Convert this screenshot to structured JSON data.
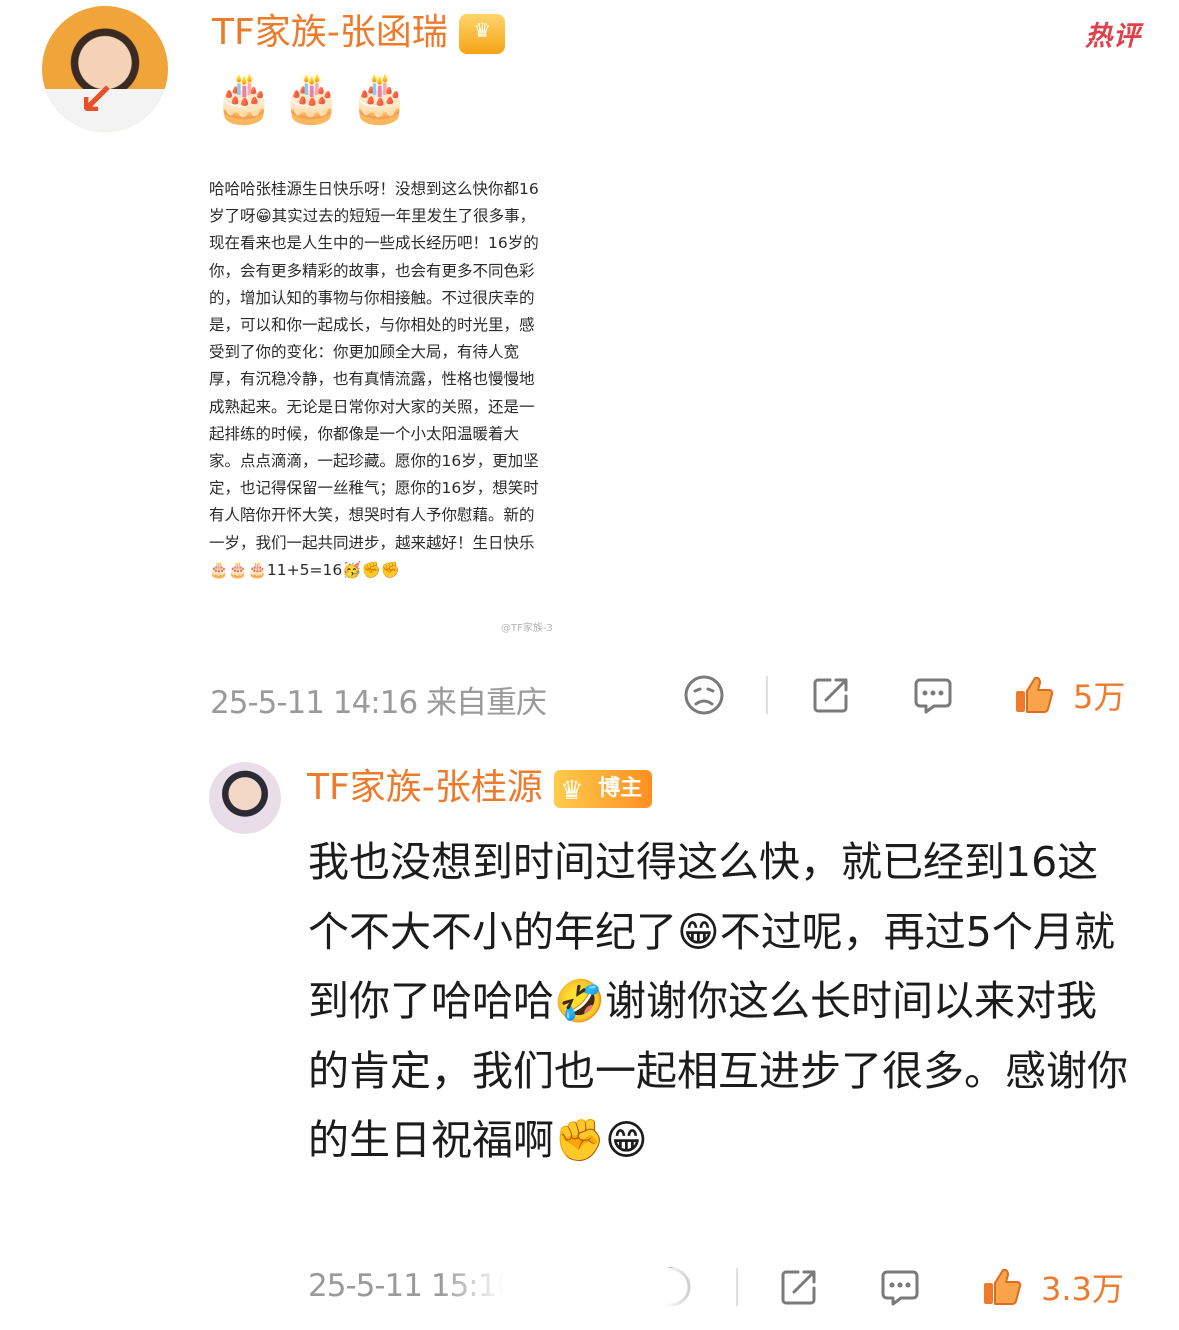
{
  "top_comment": {
    "username": "TF家族-张函瑞",
    "hot_tag": "热评",
    "emoji_line": "🎂🎂🎂",
    "image_letter": "哈哈哈张桂源生日快乐呀！没想到这么快你都16\n岁了呀😁其实过去的短短一年里发生了很多事，\n现在看来也是人生中的一些成长经历吧！16岁的\n你，会有更多精彩的故事，也会有更多不同色彩\n的，增加认知的事物与你相接触。不过很庆幸的\n是，可以和你一起成长，与你相处的时光里，感\n受到了你的变化：你更加顾全大局，有待人宽\n厚，有沉稳冷静，也有真情流露，性格也慢慢地\n成熟起来。无论是日常你对大家的关照，还是一\n起排练的时候，你都像是一个小太阳温暖着大\n家。点点滴滴，一起珍藏。愿你的16岁，更加坚\n定，也记得保留一丝稚气；愿你的16岁，想笑时\n有人陪你开怀大笑，想哭时有人予你慰藉。新的\n一岁，我们一起共同进步，越来越好！生日快乐\n🎂🎂🎂11+5=16🥳✊✊",
    "watermark": "@TF家族-3",
    "timestamp": "25-5-11 14:16",
    "location": "来自重庆",
    "like_count": "5万",
    "icons": [
      "dislike-face-icon",
      "share-icon",
      "comment-icon",
      "thumbs-up-icon"
    ]
  },
  "reply": {
    "username": "TF家族-张桂源",
    "badge_label": "博主",
    "text": "我也没想到时间过得这么快，就已经到16这个不大不小的年纪了😁不过呢，再过5个月就到你了哈哈哈🤣谢谢你这么长时间以来对我的肯定，我们也一起相互进步了很多。感谢你的生日祝福啊✊😁",
    "timestamp": "25-5-11 15:10",
    "like_count": "3.3万"
  },
  "colors": {
    "username": "#ee7a2b",
    "like": "#ee7a2b",
    "hot_tag": "#e0404a",
    "meta": "#9a9a9a"
  }
}
